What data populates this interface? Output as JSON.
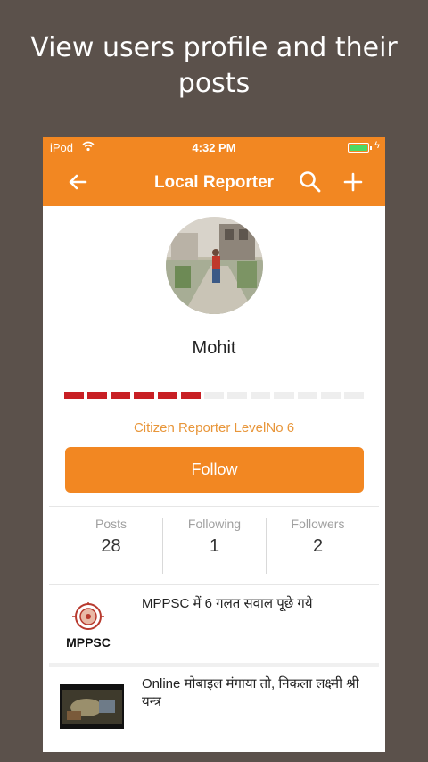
{
  "promo": {
    "line1": "View users profile and their",
    "line2": "posts"
  },
  "status_bar": {
    "carrier": "iPod",
    "time": "4:32 PM",
    "battery_color": "#4cd964"
  },
  "navbar": {
    "title": "Local Reporter",
    "back_icon": "arrow-left-icon",
    "search_icon": "search-icon",
    "add_icon": "plus-icon"
  },
  "profile": {
    "name": "Mohit",
    "level_label": "Citizen Reporter LevelNo 6",
    "level_filled": 6,
    "level_total": 13,
    "follow_label": "Follow"
  },
  "stats": [
    {
      "label": "Posts",
      "value": "28"
    },
    {
      "label": "Following",
      "value": "1"
    },
    {
      "label": "Followers",
      "value": "2"
    }
  ],
  "posts": [
    {
      "title": "MPPSC में  6 गलत सवाल पूछे गये",
      "thumb_label": "MPPSC"
    },
    {
      "title": "Online मोबाइल मंगाया तो, निकला लक्ष्मी श्री यन्त्र"
    }
  ],
  "colors": {
    "accent": "#f28722",
    "level_on": "#c81f24",
    "background": "#5b514b"
  }
}
